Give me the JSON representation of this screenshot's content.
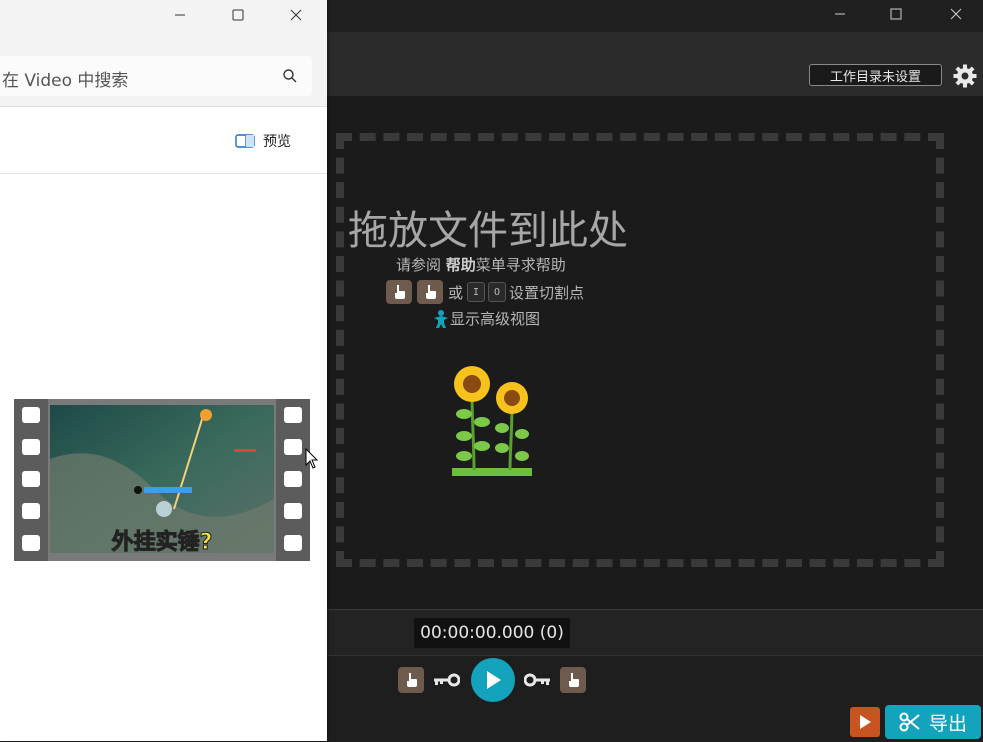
{
  "explorer": {
    "search_placeholder": "在 Video 中搜索",
    "preview_label": "预览",
    "thumbnail_caption": "外挂实锤?"
  },
  "app": {
    "workdir_label": "工作目录未设置",
    "drop_title": "拖放文件到此处",
    "help_prefix": "请参阅 ",
    "help_bold": "帮助",
    "help_suffix": "菜单寻求帮助",
    "cut_or": "或",
    "key_i": "I",
    "key_o": "O",
    "cut_suffix": "设置切割点",
    "advanced_view": "显示高级视图",
    "timecode": "00:00:00.000 (0)",
    "export_label": "导出"
  },
  "colors": {
    "accent": "#14a3bd",
    "finger_btn": "#6f5a4e",
    "record_btn": "#c8551f"
  },
  "icons": [
    "minimize-icon",
    "maximize-icon",
    "close-icon",
    "gear-icon",
    "search-icon",
    "preview-pane-icon",
    "pointing-finger-icon",
    "key-icon",
    "play-icon",
    "scissors-icon",
    "sunflower-icon",
    "advanced-view-icon",
    "mouse-cursor-icon"
  ]
}
